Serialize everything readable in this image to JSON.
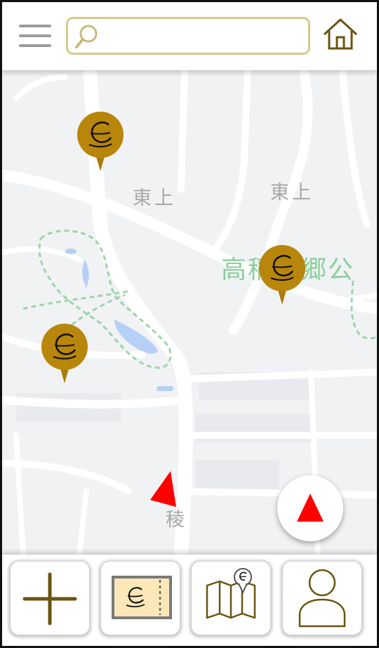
{
  "header": {
    "search_value": "",
    "search_placeholder": ""
  },
  "map": {
    "labels": [
      {
        "text": "東上"
      },
      {
        "text": "東上"
      },
      {
        "text": "高稲荷郷公"
      },
      {
        "text": "稜"
      }
    ],
    "pins": [
      {
        "icon": "coffee-cup-icon"
      },
      {
        "icon": "coffee-cup-icon"
      },
      {
        "icon": "coffee-cup-icon"
      }
    ]
  },
  "bottom_nav": {
    "tabs": [
      {
        "icon": "plus-icon"
      },
      {
        "icon": "ticket-card-icon"
      },
      {
        "icon": "map-pin-icon"
      },
      {
        "icon": "user-profile-icon"
      }
    ]
  },
  "colors": {
    "accent": "#b8860b",
    "gold_dark": "#7a5a0a",
    "search_border": "#d8c98a",
    "nav_red": "#ff1a1a",
    "park_green": "#8ccf9e",
    "water_blue": "#a9c9f5"
  }
}
